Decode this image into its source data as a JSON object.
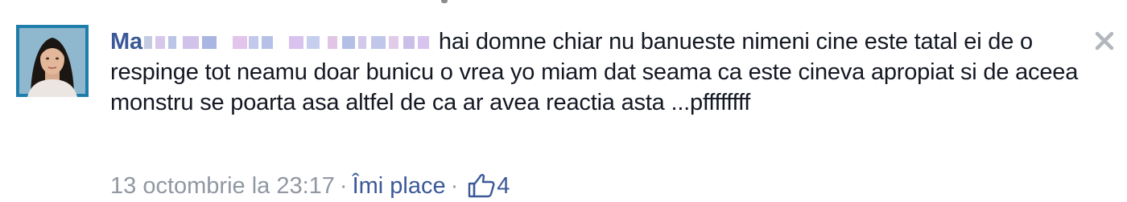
{
  "comment": {
    "author_visible": "Ma",
    "text": "hai domne chiar nu banueste nimeni cine este tatal ei de o respinge tot neamu doar bunicu o vrea yo miam dat seama ca este cineva apropiat si de aceea monstru se poarta asa altfel de ca ar avea reactia asta ...pffffffff",
    "timestamp": "13 octombrie la 23:17",
    "separator": "·",
    "like_label": "Îmi place",
    "like_count": "4"
  },
  "icons": {
    "avatar": "profile-photo",
    "thumb": "thumbs-up-icon",
    "close": "close-icon"
  },
  "colors": {
    "author": "#3b5998",
    "text": "#141823",
    "meta": "#9197a3",
    "link": "#3b5998",
    "avatar_bg": "#1f7dab"
  }
}
